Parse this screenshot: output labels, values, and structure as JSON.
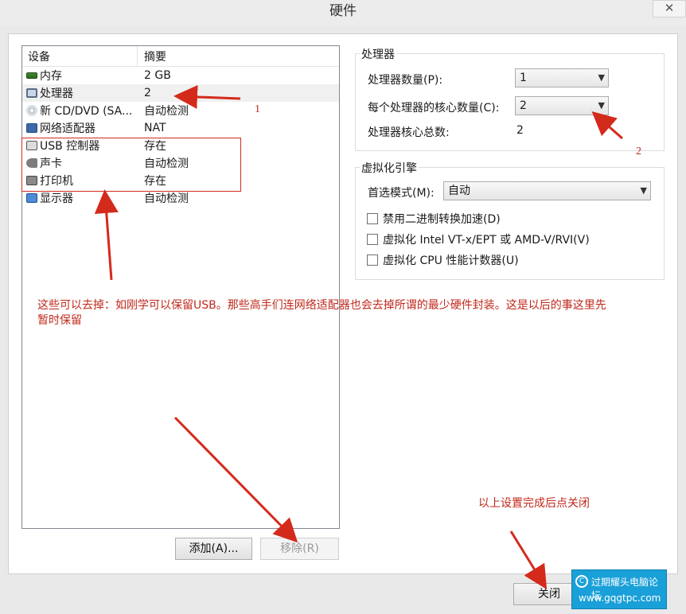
{
  "window": {
    "title": "硬件",
    "close_glyph": "✕"
  },
  "device_list": {
    "headers": {
      "device": "设备",
      "summary": "摘要"
    },
    "rows": [
      {
        "name": "内存",
        "summary": "2 GB",
        "icon": "memory-icon"
      },
      {
        "name": "处理器",
        "summary": "2",
        "icon": "processor-icon"
      },
      {
        "name": "新 CD/DVD (SA...",
        "summary": "自动检测",
        "icon": "cd-dvd-icon"
      },
      {
        "name": "网络适配器",
        "summary": "NAT",
        "icon": "network-adapter-icon"
      },
      {
        "name": "USB 控制器",
        "summary": "存在",
        "icon": "usb-icon"
      },
      {
        "name": "声卡",
        "summary": "自动检测",
        "icon": "sound-card-icon"
      },
      {
        "name": "打印机",
        "summary": "存在",
        "icon": "printer-icon"
      },
      {
        "name": "显示器",
        "summary": "自动检测",
        "icon": "display-icon"
      }
    ],
    "add_button": "添加(A)...",
    "remove_button": "移除(R)"
  },
  "processor": {
    "group_title": "处理器",
    "count_label": "处理器数量(P):",
    "count_value": "1",
    "cores_label": "每个处理器的核心数量(C):",
    "cores_value": "2",
    "total_label": "处理器核心总数:",
    "total_value": "2"
  },
  "virtualization": {
    "group_title": "虚拟化引擎",
    "mode_label": "首选模式(M):",
    "mode_value": "自动",
    "options": [
      "禁用二进制转换加速(D)",
      "虚拟化 Intel VT-x/EPT 或 AMD-V/RVI(V)",
      "虚拟化 CPU 性能计数器(U)"
    ]
  },
  "close_button": "关闭",
  "annotations": {
    "num1": "1",
    "num2": "2",
    "note_line1": "这些可以去掉：如刚学可以保留USB。那些高手们连网络适配器也会去掉所谓的最少硬件封装。这是以后的事这里先",
    "note_line2": "暂时保留",
    "close_note": "以上设置完成后点关闭"
  },
  "watermark": {
    "name": "过期耀头电脑论坛",
    "url": "www.gqgtpc.com"
  },
  "colors": {
    "annotation_red": "#c0281b",
    "watermark_blue": "#1aa0d8"
  }
}
